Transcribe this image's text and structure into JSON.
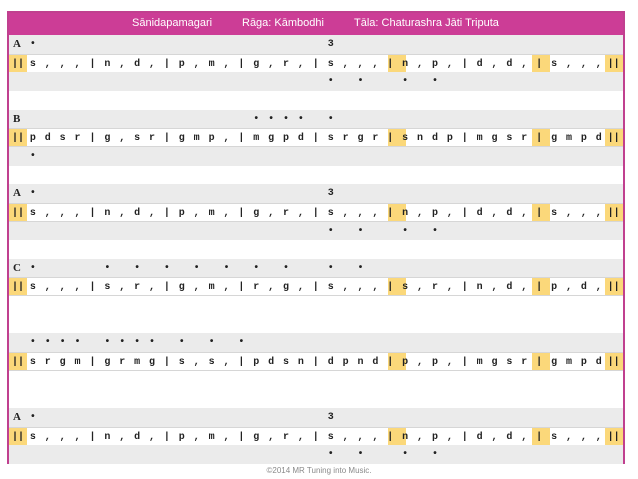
{
  "header": {
    "composition": "Sānidapamagari",
    "raga": "Rāga:  Kāmbodhi",
    "tala": "Tāla:  Chaturashra Jāti Triputa"
  },
  "footer": "©2014 MR Tuning into Music.",
  "colors": {
    "title_bg": "#cc3d96",
    "border": "#c0408f",
    "shade": "#ebebeb",
    "highlight": "#fbd87a"
  },
  "rows": [
    {
      "kind": "marks",
      "label": "A",
      "cells": {
        "1": "•",
        "21": "3"
      }
    },
    {
      "kind": "notes",
      "cells": [
        "||",
        "s",
        ",",
        ",",
        ",",
        "|",
        "n",
        ",",
        "d",
        ",",
        "|",
        "p",
        ",",
        "m",
        ",",
        "|",
        "g",
        ",",
        "r",
        ",",
        "|",
        "s",
        ",",
        ",",
        ",",
        "|",
        "n",
        ",",
        "p",
        ",",
        "|",
        "d",
        ",",
        "d",
        ",",
        "|",
        "s",
        ",",
        ",",
        ",",
        "||"
      ]
    },
    {
      "kind": "marks",
      "cells": {
        "21": "•",
        "23": "•",
        "26": "•",
        "28": "•"
      }
    },
    {
      "kind": "gap"
    },
    {
      "kind": "marks",
      "label": "B",
      "cells": {
        "16": "•",
        "17": "•",
        "18": "•",
        "19": "•",
        "21": "•"
      }
    },
    {
      "kind": "notes",
      "cells": [
        "||",
        "p",
        "d",
        "s",
        "r",
        "|",
        "g",
        ",",
        "s",
        "r",
        "|",
        "g",
        "m",
        "p",
        ",",
        "|",
        "m",
        "g",
        "p",
        "d",
        "|",
        "s",
        "r",
        "g",
        "r",
        "|",
        "s",
        "n",
        "d",
        "p",
        "|",
        "m",
        "g",
        "s",
        "r",
        "|",
        "g",
        "m",
        "p",
        "d",
        "||"
      ]
    },
    {
      "kind": "marks",
      "cells": {
        "1": "•"
      }
    },
    {
      "kind": "gap"
    },
    {
      "kind": "marks",
      "label": "A",
      "cells": {
        "1": "•",
        "21": "3"
      }
    },
    {
      "kind": "notes",
      "cells": [
        "||",
        "s",
        ",",
        ",",
        ",",
        "|",
        "n",
        ",",
        "d",
        ",",
        "|",
        "p",
        ",",
        "m",
        ",",
        "|",
        "g",
        ",",
        "r",
        ",",
        "|",
        "s",
        ",",
        ",",
        ",",
        "|",
        "n",
        ",",
        "p",
        ",",
        "|",
        "d",
        ",",
        "d",
        ",",
        "|",
        "s",
        ",",
        ",",
        ",",
        "||"
      ]
    },
    {
      "kind": "marks",
      "cells": {
        "21": "•",
        "23": "•",
        "26": "•",
        "28": "•"
      }
    },
    {
      "kind": "gap"
    },
    {
      "kind": "marks",
      "label": "C",
      "cells": {
        "1": "•",
        "6": "•",
        "8": "•",
        "10": "•",
        "12": "•",
        "14": "•",
        "16": "•",
        "18": "•",
        "21": "•",
        "23": "•"
      }
    },
    {
      "kind": "notes",
      "cells": [
        "||",
        "s",
        ",",
        ",",
        ",",
        "|",
        "s",
        ",",
        "r",
        ",",
        "|",
        "g",
        ",",
        "m",
        ",",
        "|",
        "r",
        ",",
        "g",
        ",",
        "|",
        "s",
        ",",
        ",",
        ",",
        "|",
        "s",
        ",",
        "r",
        ",",
        "|",
        "n",
        ",",
        "d",
        ",",
        "|",
        "p",
        ",",
        "d",
        ",",
        "||"
      ]
    },
    {
      "kind": "gap"
    },
    {
      "kind": "gap"
    },
    {
      "kind": "marks",
      "cells": {
        "1": "•",
        "2": "•",
        "3": "•",
        "4": "•",
        "6": "•",
        "7": "•",
        "8": "•",
        "9": "•",
        "11": "•",
        "13": "•",
        "15": "•"
      }
    },
    {
      "kind": "notes",
      "cells": [
        "||",
        "s",
        "r",
        "g",
        "m",
        "|",
        "g",
        "r",
        "m",
        "g",
        "|",
        "s",
        ",",
        "s",
        ",",
        "|",
        "p",
        "d",
        "s",
        "n",
        "|",
        "d",
        "p",
        "n",
        "d",
        "|",
        "p",
        ",",
        "p",
        ",",
        "|",
        "m",
        "g",
        "s",
        "r",
        "|",
        "g",
        "m",
        "p",
        "d",
        "||"
      ]
    },
    {
      "kind": "gap"
    },
    {
      "kind": "gap"
    },
    {
      "kind": "marks",
      "label": "A",
      "cells": {
        "1": "•",
        "21": "3"
      }
    },
    {
      "kind": "notes",
      "cells": [
        "||",
        "s",
        ",",
        ",",
        ",",
        "|",
        "n",
        ",",
        "d",
        ",",
        "|",
        "p",
        ",",
        "m",
        ",",
        "|",
        "g",
        ",",
        "r",
        ",",
        "|",
        "s",
        ",",
        ",",
        ",",
        "|",
        "n",
        ",",
        "p",
        ",",
        "|",
        "d",
        ",",
        "d",
        ",",
        "|",
        "s",
        ",",
        ",",
        ",",
        "||"
      ]
    },
    {
      "kind": "marks",
      "cells": {
        "21": "•",
        "23": "•",
        "26": "•",
        "28": "•"
      }
    }
  ]
}
